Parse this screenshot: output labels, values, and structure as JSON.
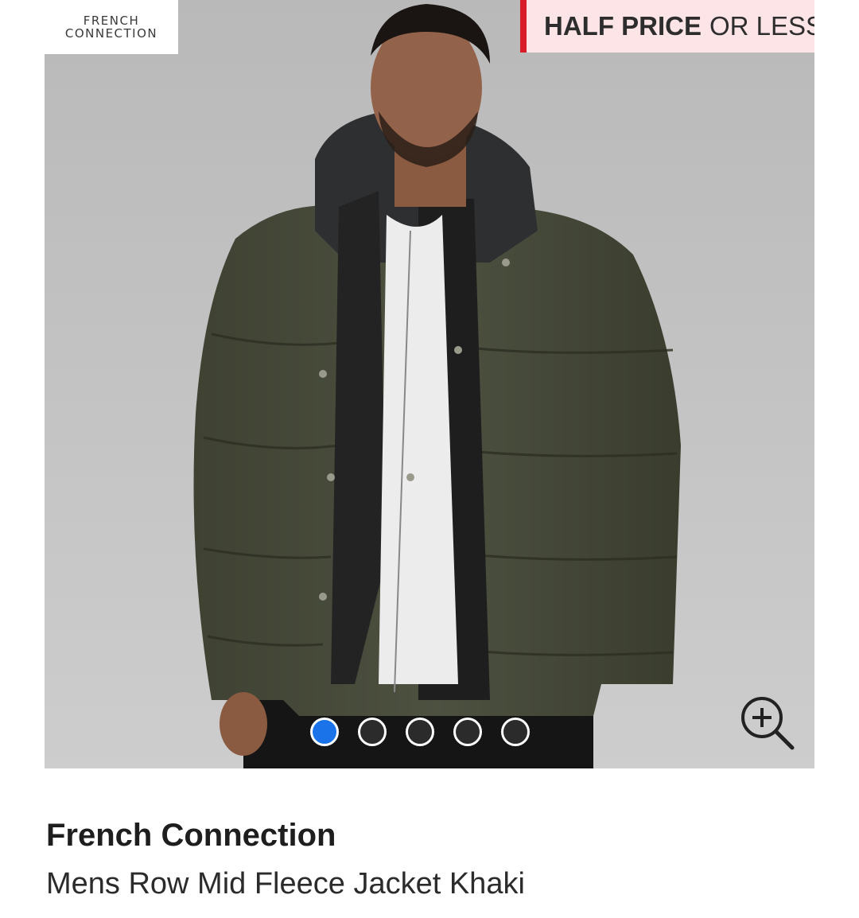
{
  "logo": {
    "line1": "FRENCH",
    "line2": "CONNECTION"
  },
  "promo": {
    "bold": "HALF PRICE",
    "rest": "OR LESS",
    "accent_color": "#d91c2a",
    "bg_color": "#fde4e6"
  },
  "gallery": {
    "total_images": 5,
    "active_index": 0,
    "active_color": "#1a73e8",
    "zoom_icon": "zoom-in-icon"
  },
  "product": {
    "brand": "French Connection",
    "name": "Mens Row Mid Fleece Jacket Khaki"
  }
}
